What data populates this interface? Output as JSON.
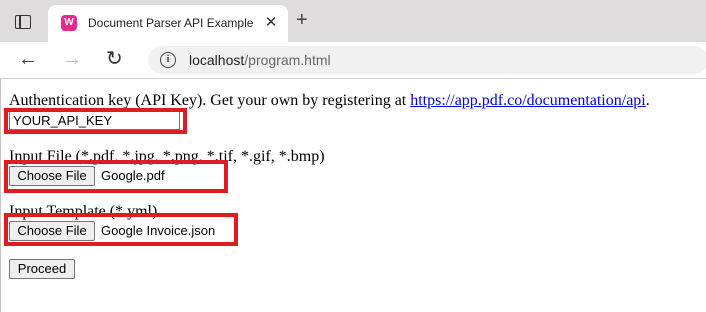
{
  "browser": {
    "tab_title": "Document Parser API Example",
    "favicon_icon": "webapp-favicon-icon",
    "new_tab_label": "+",
    "address": {
      "host": "localhost",
      "path": "/program.html"
    }
  },
  "page": {
    "auth_label_prefix": "Authentication key (API Key). Get your own by registering at ",
    "auth_link": "https://app.pdf.co/documentation/api",
    "auth_label_suffix": ".",
    "api_key_value": "YOUR_API_KEY",
    "input_file_label": "Input File (*.pdf, *.jpg, *.png, *.tif, *.gif, *.bmp)",
    "choose_file_label": "Choose File",
    "input_file_name": "Google.pdf",
    "template_label": "Input Template (*.yml)",
    "template_file_name": "Google Invoice.json",
    "proceed_label": "Proceed"
  },
  "highlight_color": "#e01b24"
}
